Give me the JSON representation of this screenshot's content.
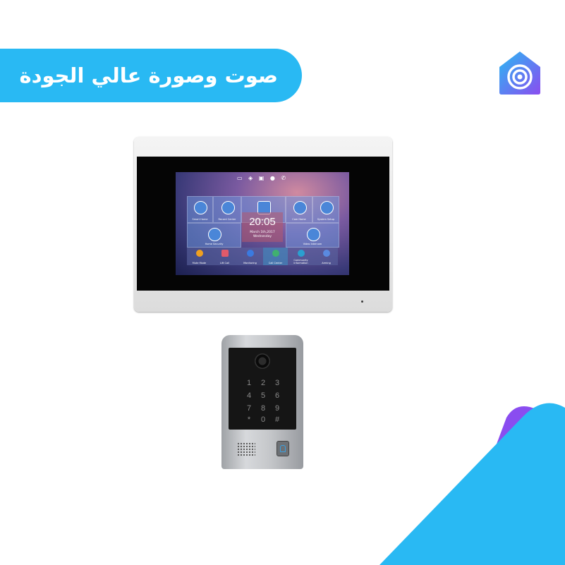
{
  "banner": {
    "text": "صوت وصورة عالي الجودة",
    "color": "#29b9f3"
  },
  "brand": {
    "logo": "house-signal-icon",
    "colors": [
      "#29b9f3",
      "#8a4df0"
    ]
  },
  "monitor": {
    "status_icons": "▭ ◈ ▣ ● ✆",
    "time": "20:05",
    "date": "March 1th,2017",
    "weekday": "Wednesday",
    "tiles": [
      {
        "label": "Smart Home"
      },
      {
        "label": "Record Center"
      },
      {
        "label": "Monitoring Center"
      },
      {
        "label": "Cam Home"
      },
      {
        "label": "System Setup"
      },
      {
        "label": "Home Security"
      },
      {
        "label": "Video Intercom"
      }
    ],
    "bottom": [
      {
        "label": "Mute Mode",
        "color": "#f0a020"
      },
      {
        "label": "Lift Call",
        "color": "#e05a6a"
      },
      {
        "label": "Monitoring",
        "color": "#3a7ae0"
      },
      {
        "label": "Call Center",
        "color": "#40b070"
      },
      {
        "label": "Community Information",
        "color": "#2aa0d0"
      },
      {
        "label": "Arming",
        "color": "#5a8ae0"
      }
    ]
  },
  "door_panel": {
    "keys": [
      "1",
      "2",
      "3",
      "4",
      "5",
      "6",
      "7",
      "8",
      "9",
      "*",
      "0",
      "#"
    ]
  }
}
